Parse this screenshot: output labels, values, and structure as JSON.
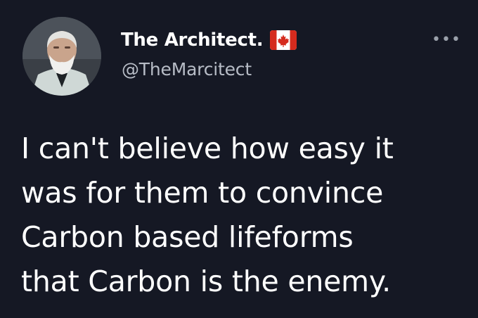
{
  "tweet": {
    "display_name": "The Architect.",
    "handle": "@TheMarcitect",
    "more_glyph": "•••",
    "text": "I can't believe how easy it\nwas for them to convince\nCarbon based lifeforms\nthat Carbon is the enemy.",
    "flag_icon": "canada-flag-icon",
    "colors": {
      "background": "#151824",
      "text": "#ffffff",
      "secondary_text": "#b7bcc6",
      "flag_red": "#d52b1e"
    }
  }
}
